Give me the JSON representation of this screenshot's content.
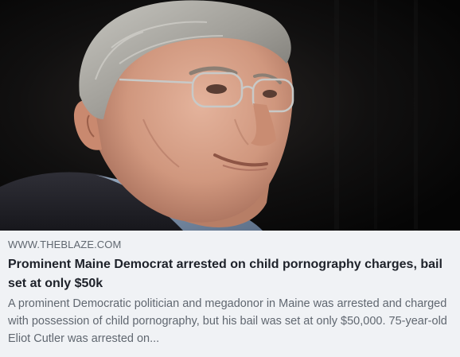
{
  "link_preview": {
    "image": {
      "subject": "portrait-photo",
      "colors": {
        "background": "#0b0b0b",
        "hair": "#a9a9a4",
        "skin": "#d79f87",
        "jacket": "#25252d",
        "shirt": "#7a8ea6"
      }
    },
    "source": "WWW.THEBLAZE.COM",
    "headline": "Prominent Maine Democrat arrested on child pornography charges, bail set at only $50k",
    "description": "A prominent Democratic politician and megadonor in Maine was arrested and charged with possession of child pornography, but his bail was set at only $50,000. 75-year-old Eliot Cutler was arrested on..."
  },
  "colors": {
    "panel_background": "#f0f2f5",
    "source_text": "#606770",
    "headline_text": "#1d2129",
    "description_text": "#606770"
  }
}
